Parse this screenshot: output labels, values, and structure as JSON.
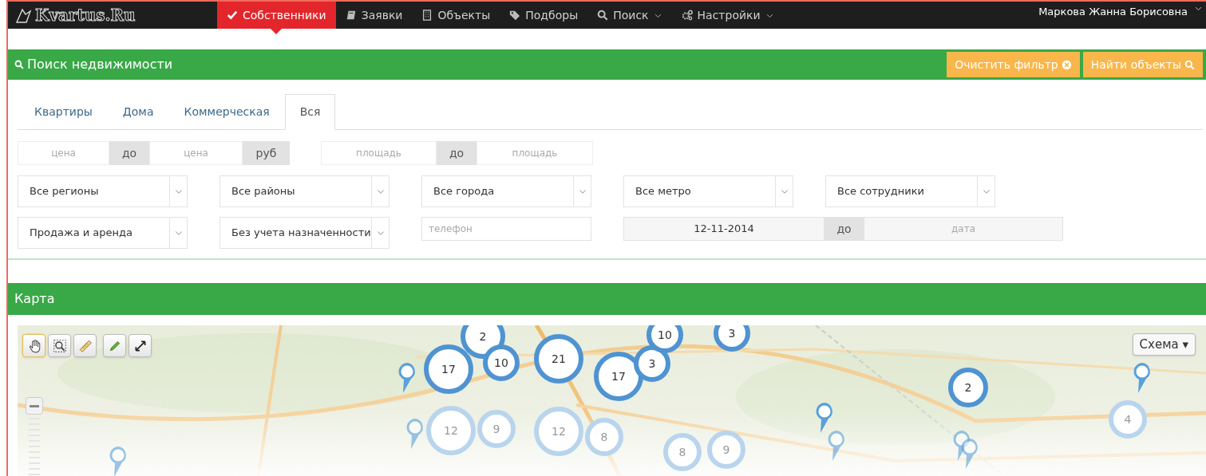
{
  "navbar": {
    "logo": "Kvartus.Ru",
    "items": [
      {
        "label": "Собственники",
        "kind": "check",
        "selected": true,
        "dropdown": false
      },
      {
        "label": "Заявки",
        "kind": "book",
        "selected": false,
        "dropdown": false
      },
      {
        "label": "Объекты",
        "kind": "building",
        "selected": false,
        "dropdown": false
      },
      {
        "label": "Подборы",
        "kind": "tags",
        "selected": false,
        "dropdown": false
      },
      {
        "label": "Поиск",
        "kind": "search",
        "selected": false,
        "dropdown": true
      },
      {
        "label": "Настройки",
        "kind": "gears",
        "selected": false,
        "dropdown": true
      }
    ],
    "user": "Маркова Жанна Борисовна"
  },
  "search_panel": {
    "title": "Поиск недвижимости",
    "buttons": [
      {
        "label": "Очистить фильтр",
        "kind": "clear"
      },
      {
        "label": "Найти объекты",
        "kind": "find"
      }
    ],
    "tabs": [
      {
        "label": "Квартиры",
        "selected": false
      },
      {
        "label": "Дома",
        "selected": false
      },
      {
        "label": "Коммерческая",
        "selected": false
      },
      {
        "label": "Вся",
        "selected": true
      }
    ],
    "price_range": {
      "from_placeholder": "цена",
      "separator": "до",
      "to_placeholder": "цена",
      "unit": "руб"
    },
    "area_range": {
      "from_placeholder": "площадь",
      "separator": "до",
      "to_placeholder": "площадь"
    },
    "selects_row_1": [
      "Все регионы",
      "Все районы",
      "Все города",
      "Все метро",
      "Все сотрудники"
    ],
    "selects_row_2": [
      "Продажа и аренда",
      "Без учета назначенности"
    ],
    "phone": {
      "placeholder": "телефон"
    },
    "date_range": {
      "from_value": "12-11-2014",
      "separator": "до",
      "to_placeholder": "дата"
    }
  },
  "map_panel": {
    "title": "Карта",
    "map_type_button": "Схема ▾",
    "tools": [
      {
        "kind": "hand",
        "selected": true
      },
      {
        "kind": "zoom-area",
        "selected": false
      },
      {
        "kind": "ruler",
        "selected": false
      },
      {
        "kind": "pencil",
        "selected": false
      },
      {
        "kind": "expand",
        "selected": false
      }
    ],
    "clusters": [
      {
        "count": "2"
      },
      {
        "count": "17"
      },
      {
        "count": "10"
      },
      {
        "count": "21"
      },
      {
        "count": "17"
      },
      {
        "count": "3"
      },
      {
        "count": "10"
      },
      {
        "count": "3"
      },
      {
        "count": "12"
      },
      {
        "count": "9"
      },
      {
        "count": "12"
      },
      {
        "count": "8"
      },
      {
        "count": "8"
      },
      {
        "count": "9"
      },
      {
        "count": "2"
      },
      {
        "count": "4"
      }
    ]
  }
}
